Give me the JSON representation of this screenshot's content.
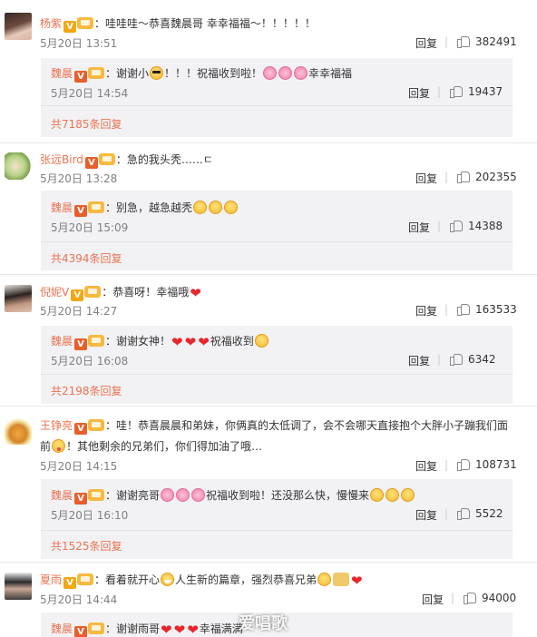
{
  "comments": [
    {
      "user": "杨紫",
      "badge": "V",
      "text": "：哇哇哇～恭喜魏晨哥 幸幸福福～！！！！！",
      "time": "5月20日 13:51",
      "reply_label": "回复",
      "likes": "382491",
      "reply": {
        "user": "魏晨",
        "badge": "V",
        "text_a": "：谢谢小",
        "text_b": "！！！祝福收到啦！",
        "text_c": "幸幸福福",
        "time": "5月20日 14:54",
        "reply_label": "回复",
        "likes": "19437"
      },
      "more": "共7185条回复"
    },
    {
      "user": "张远Bird",
      "badge": "V",
      "text": "：急的我头秃……ㄷ",
      "time": "5月20日 13:28",
      "reply_label": "回复",
      "likes": "202355",
      "reply": {
        "user": "魏晨",
        "badge": "V",
        "text_a": "：别急，越急越秃",
        "time": "5月20日 15:09",
        "reply_label": "回复",
        "likes": "14388"
      },
      "more": "共4394条回复"
    },
    {
      "user": "倪妮V",
      "badge": "V",
      "text": "：恭喜呀！幸福哦",
      "time": "5月20日 14:27",
      "reply_label": "回复",
      "likes": "163533",
      "reply": {
        "user": "魏晨",
        "badge": "V",
        "text_a": "：谢谢女神！",
        "text_b": "祝福收到",
        "time": "5月20日 16:08",
        "reply_label": "回复",
        "likes": "6342"
      },
      "more": "共2198条回复"
    },
    {
      "user": "王铮亮",
      "badge": "V",
      "text_line1": "：哇！恭喜晨晨和弟妹，你俩真的太低调了，会不会哪天直接抱个大胖小子蹦我们面",
      "text_line2a": "前",
      "text_line2b": "！其他剩余的兄弟们，你们得加油了哦…",
      "time": "5月20日 14:15",
      "reply_label": "回复",
      "likes": "108731",
      "reply": {
        "user": "魏晨",
        "badge": "V",
        "text_a": "：谢谢亮哥",
        "text_b": "祝福收到啦！还没那么快，慢慢来",
        "time": "5月20日 16:10",
        "reply_label": "回复",
        "likes": "5522"
      },
      "more": "共1525条回复"
    },
    {
      "user": "夏雨",
      "badge": "V",
      "text_a": "：看着就开心",
      "text_b": "人生新的篇章，强烈恭喜兄弟",
      "time": "5月20日 14:44",
      "reply_label": "回复",
      "likes": "94000",
      "reply": {
        "user": "魏晨",
        "badge": "V",
        "text_a": "：谢谢雨哥",
        "text_b": "幸福满满",
        "time": "",
        "reply_label": "",
        "likes": ""
      }
    }
  ],
  "watermark": "爱唱歌",
  "colors": {
    "name": "#eb7350",
    "reply_bg": "#f2f2f5",
    "heart": "#e8262d"
  }
}
